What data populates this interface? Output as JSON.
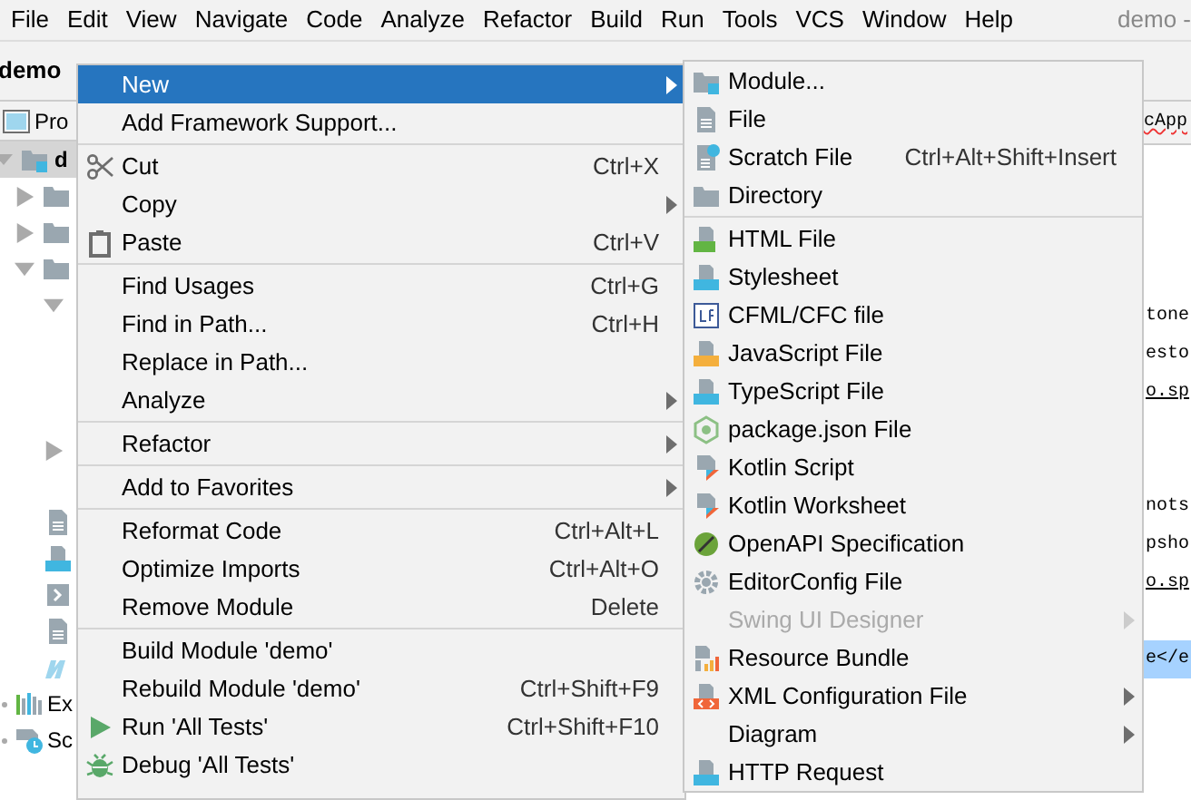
{
  "menubar": [
    "File",
    "Edit",
    "View",
    "Navigate",
    "Code",
    "Analyze",
    "Refactor",
    "Build",
    "Run",
    "Tools",
    "VCS",
    "Window",
    "Help"
  ],
  "window_title": "demo - ",
  "toolbar": {
    "project": "demo"
  },
  "project_panel": {
    "tab": "Pro",
    "tree": [
      {
        "text": "d",
        "selected": true,
        "expanded": true
      },
      {
        "text": "Ex",
        "selected": false,
        "expanded": false
      },
      {
        "text": "Sc",
        "selected": false,
        "expanded": false
      }
    ]
  },
  "editor": {
    "tab": "cApp",
    "lines": [
      {
        "text": "tone",
        "selected": false
      },
      {
        "text": "esto",
        "selected": false
      },
      {
        "text": "o.sp",
        "selected": false
      },
      {
        "text": "nots",
        "selected": false
      },
      {
        "text": "psho",
        "selected": false
      },
      {
        "text": "o.sp",
        "selected": false
      },
      {
        "text": "e</e",
        "selected": true
      }
    ]
  },
  "context_menu": {
    "items": [
      {
        "kind": "item",
        "label": "New",
        "submenu": true,
        "selected": true
      },
      {
        "kind": "item",
        "label": "Add Framework Support...",
        "submenu": false,
        "selected": false
      },
      {
        "kind": "separator"
      },
      {
        "kind": "item",
        "label": "Cut",
        "shortcut": "Ctrl+X",
        "submenu": false,
        "selected": false
      },
      {
        "kind": "item",
        "label": "Copy",
        "submenu": true,
        "selected": false
      },
      {
        "kind": "item",
        "label": "Paste",
        "shortcut": "Ctrl+V",
        "submenu": false,
        "selected": false
      },
      {
        "kind": "separator"
      },
      {
        "kind": "item",
        "label": "Find Usages",
        "shortcut": "Ctrl+G",
        "submenu": false,
        "selected": false
      },
      {
        "kind": "item",
        "label": "Find in Path...",
        "shortcut": "Ctrl+H",
        "submenu": false,
        "selected": false
      },
      {
        "kind": "item",
        "label": "Replace in Path...",
        "submenu": false,
        "selected": false
      },
      {
        "kind": "item",
        "label": "Analyze",
        "submenu": true,
        "selected": false
      },
      {
        "kind": "separator"
      },
      {
        "kind": "item",
        "label": "Refactor",
        "submenu": true,
        "selected": false
      },
      {
        "kind": "separator"
      },
      {
        "kind": "item",
        "label": "Add to Favorites",
        "submenu": true,
        "selected": false
      },
      {
        "kind": "separator"
      },
      {
        "kind": "item",
        "label": "Reformat Code",
        "shortcut": "Ctrl+Alt+L",
        "submenu": false,
        "selected": false
      },
      {
        "kind": "item",
        "label": "Optimize Imports",
        "shortcut": "Ctrl+Alt+O",
        "submenu": false,
        "selected": false
      },
      {
        "kind": "item",
        "label": "Remove Module",
        "shortcut": "Delete",
        "submenu": false,
        "selected": false
      },
      {
        "kind": "separator"
      },
      {
        "kind": "item",
        "label": "Build Module 'demo'",
        "submenu": false,
        "selected": false
      },
      {
        "kind": "item",
        "label": "Rebuild Module 'demo'",
        "shortcut": "Ctrl+Shift+F9",
        "submenu": false,
        "selected": false
      },
      {
        "kind": "item",
        "label": "Run 'All Tests'",
        "shortcut": "Ctrl+Shift+F10",
        "submenu": false,
        "selected": false
      },
      {
        "kind": "item",
        "label": "Debug 'All Tests'",
        "submenu": false,
        "selected": false
      }
    ]
  },
  "new_submenu": {
    "items": [
      {
        "kind": "item",
        "label": "Module...",
        "submenu": false,
        "disabled": false
      },
      {
        "kind": "item",
        "label": "File",
        "submenu": false,
        "disabled": false
      },
      {
        "kind": "item",
        "label": "Scratch File",
        "shortcut": "Ctrl+Alt+Shift+Insert",
        "submenu": false,
        "disabled": false
      },
      {
        "kind": "item",
        "label": "Directory",
        "submenu": false,
        "disabled": false
      },
      {
        "kind": "separator"
      },
      {
        "kind": "item",
        "label": "HTML File",
        "submenu": false,
        "disabled": false
      },
      {
        "kind": "item",
        "label": "Stylesheet",
        "submenu": false,
        "disabled": false
      },
      {
        "kind": "item",
        "label": "CFML/CFC file",
        "submenu": false,
        "disabled": false
      },
      {
        "kind": "item",
        "label": "JavaScript File",
        "submenu": false,
        "disabled": false
      },
      {
        "kind": "item",
        "label": "TypeScript File",
        "submenu": false,
        "disabled": false
      },
      {
        "kind": "item",
        "label": "package.json File",
        "submenu": false,
        "disabled": false
      },
      {
        "kind": "item",
        "label": "Kotlin Script",
        "submenu": false,
        "disabled": false
      },
      {
        "kind": "item",
        "label": "Kotlin Worksheet",
        "submenu": false,
        "disabled": false
      },
      {
        "kind": "item",
        "label": "OpenAPI Specification",
        "submenu": false,
        "disabled": false
      },
      {
        "kind": "item",
        "label": "EditorConfig File",
        "submenu": false,
        "disabled": false
      },
      {
        "kind": "item",
        "label": "Swing UI Designer",
        "submenu": true,
        "disabled": true
      },
      {
        "kind": "item",
        "label": "Resource Bundle",
        "submenu": false,
        "disabled": false
      },
      {
        "kind": "item",
        "label": "XML Configuration File",
        "submenu": true,
        "disabled": false
      },
      {
        "kind": "item",
        "label": "Diagram",
        "submenu": true,
        "disabled": false
      },
      {
        "kind": "item",
        "label": "HTTP Request",
        "submenu": false,
        "disabled": false
      }
    ]
  }
}
